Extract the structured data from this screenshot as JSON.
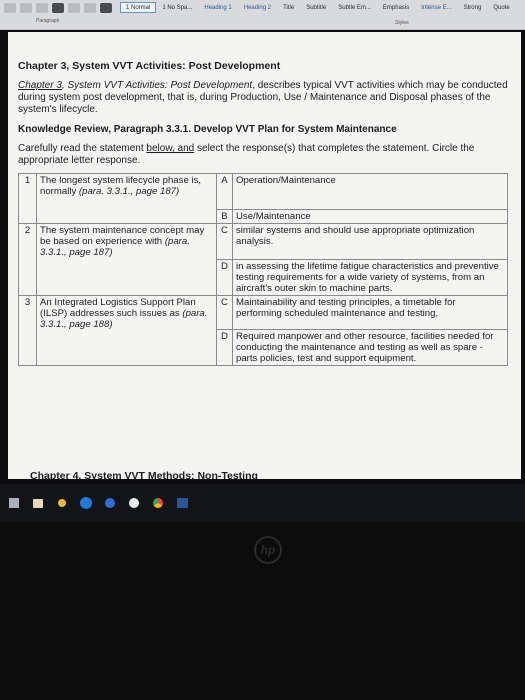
{
  "ribbon": {
    "styles": [
      "1 Normal",
      "1 No Spa...",
      "Heading 1",
      "Heading 2",
      "Title",
      "Subtitle",
      "Subtle Em...",
      "Emphasis",
      "Intense E...",
      "Strong",
      "Quote"
    ],
    "styles_pane_label": "Styles",
    "paragraph_label": "Paragraph"
  },
  "doc": {
    "chapter_heading": "Chapter 3, System VVT Activities: Post Development",
    "intro_label": "Chapter 3",
    "intro_comma": ",",
    "intro_italic": " System VVT Activities: Post Development",
    "intro_rest": ", describes typical VVT activities which may be conducted during system post development, that is, during Production, Use / Maintenance and Disposal phases of the system's lifecycle.",
    "kr_heading": "Knowledge Review, Paragraph 3.3.1.  Develop VVT Plan for System Maintenance",
    "instruction_a": "Carefully read the statement ",
    "instruction_ul": "below, and",
    "instruction_b": " select the response(s) that completes the statement.  Circle the appropriate letter response.",
    "table": {
      "q1_num": "1",
      "q1_text": "The longest system lifecycle phase is, normally ",
      "q1_ref": "(para. 3.3.1., page 187)",
      "optA_letter": "A",
      "optA_text": "Operation/Maintenance",
      "optB_letter": "B",
      "optB_text": "Use/Maintenance",
      "q2_num": "2",
      "q2_text": "The system maintenance concept may be based on experience with ",
      "q2_ref": "(para. 3.3.1., page 187)",
      "optC1_letter": "C",
      "optC1_text": "similar systems and should use appropriate optimization analysis.",
      "optD1_letter": "D",
      "optD1_text": "in assessing the lifetime fatigue characteristics and preventive testing requirements for a wide variety of systems, from an aircraft's outer skin to machine parts.",
      "q3_num": "3",
      "q3_text": "An Integrated Logistics Support Plan (ILSP) addresses such issues as ",
      "q3_ref": "(para. 3.3.1., page 188)",
      "optC2_letter": "C",
      "optC2_text": "Maintainability and testing principles, a timetable for performing scheduled maintenance and testing,",
      "optD2_letter": "D",
      "optD2_text": "Required manpower and other resource, facilities needed for conducting the maintenance and testing as well as spare - parts policies, test and support equipment."
    },
    "next_heading": "Chapter 4, System VVT Methods: Non-Testing"
  },
  "taskbar": {
    "icons": [
      "windows-icon",
      "folder-icon",
      "location-icon",
      "hp-icon",
      "blue-circle-icon",
      "circle-icon",
      "chrome-icon",
      "word-icon"
    ]
  },
  "hp_logo_text": "hp"
}
